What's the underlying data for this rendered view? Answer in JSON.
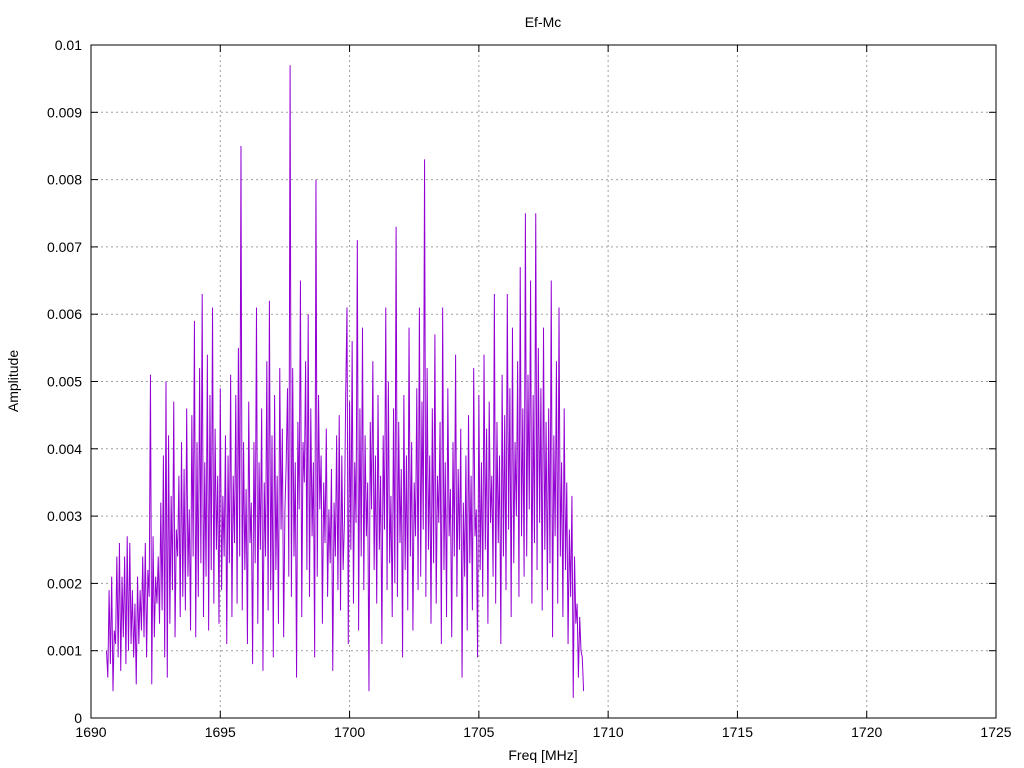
{
  "chart_data": {
    "type": "line",
    "title": "Ef-Mc",
    "xlabel": "Freq [MHz]",
    "ylabel": "Amplitude",
    "xlim": [
      1690,
      1725
    ],
    "ylim": [
      0,
      0.01
    ],
    "x_ticks": [
      "1690",
      "1695",
      "1700",
      "1705",
      "1710",
      "1715",
      "1720",
      "1725"
    ],
    "y_ticks": [
      "0",
      "0.001",
      "0.002",
      "0.003",
      "0.004",
      "0.005",
      "0.006",
      "0.007",
      "0.008",
      "0.009",
      "0.01"
    ],
    "grid": true,
    "legend": "none",
    "series": [
      {
        "color": "#9400d3",
        "x_start": 1690.6,
        "x_step": 0.05,
        "values": [
          0.001,
          0.0006,
          0.0019,
          0.0008,
          0.0021,
          0.0004,
          0.0013,
          0.0011,
          0.0024,
          0.0009,
          0.0026,
          0.0007,
          0.0021,
          0.0012,
          0.0024,
          0.0008,
          0.0027,
          0.001,
          0.0026,
          0.0011,
          0.0019,
          0.0009,
          0.0017,
          0.0005,
          0.0021,
          0.0011,
          0.0019,
          0.0013,
          0.0024,
          0.0012,
          0.0026,
          0.0009,
          0.0022,
          0.0018,
          0.0051,
          0.0005,
          0.0027,
          0.0012,
          0.0021,
          0.0017,
          0.0024,
          0.0014,
          0.0032,
          0.0016,
          0.0039,
          0.0009,
          0.005,
          0.0006,
          0.0042,
          0.0014,
          0.0033,
          0.0019,
          0.0047,
          0.0012,
          0.0028,
          0.0024,
          0.0036,
          0.0015,
          0.0041,
          0.0018,
          0.0037,
          0.0016,
          0.0046,
          0.0021,
          0.0031,
          0.0013,
          0.0045,
          0.0024,
          0.0059,
          0.0012,
          0.0041,
          0.0018,
          0.0052,
          0.0023,
          0.0063,
          0.0015,
          0.0038,
          0.0021,
          0.0054,
          0.0013,
          0.0048,
          0.0022,
          0.0061,
          0.0017,
          0.0043,
          0.0025,
          0.0036,
          0.0014,
          0.0049,
          0.0019,
          0.0033,
          0.0024,
          0.0042,
          0.0011,
          0.0039,
          0.0023,
          0.0051,
          0.0015,
          0.0036,
          0.0026,
          0.0048,
          0.0017,
          0.0055,
          0.0024,
          0.0085,
          0.0016,
          0.0041,
          0.0022,
          0.0034,
          0.0011,
          0.0047,
          0.0026,
          0.0032,
          0.0008,
          0.0041,
          0.0023,
          0.0061,
          0.0014,
          0.0038,
          0.0025,
          0.0046,
          0.0007,
          0.0035,
          0.0024,
          0.0053,
          0.0016,
          0.0062,
          0.0019,
          0.0042,
          0.0009,
          0.0048,
          0.0022,
          0.0036,
          0.0014,
          0.0052,
          0.0028,
          0.0043,
          0.0012,
          0.0031,
          0.0038,
          0.0049,
          0.0021,
          0.0097,
          0.0018,
          0.0052,
          0.0024,
          0.0038,
          0.0006,
          0.0044,
          0.0031,
          0.0065,
          0.0015,
          0.0041,
          0.0035,
          0.0053,
          0.0022,
          0.006,
          0.0018,
          0.0046,
          0.0027,
          0.0038,
          0.0009,
          0.008,
          0.0021,
          0.0048,
          0.0031,
          0.0039,
          0.0014,
          0.0035,
          0.0026,
          0.0043,
          0.0018,
          0.0031,
          0.0023,
          0.0037,
          0.0007,
          0.0032,
          0.0024,
          0.0042,
          0.0019,
          0.0045,
          0.0016,
          0.0039,
          0.0022,
          0.0029,
          0.0048,
          0.0061,
          0.0011,
          0.0047,
          0.0025,
          0.0056,
          0.0017,
          0.0038,
          0.0029,
          0.0071,
          0.0013,
          0.0046,
          0.0024,
          0.0058,
          0.0019,
          0.0042,
          0.0027,
          0.0035,
          0.0004,
          0.0044,
          0.0031,
          0.0053,
          0.0022,
          0.0039,
          0.0017,
          0.0048,
          0.0025,
          0.0036,
          0.0011,
          0.0042,
          0.0028,
          0.0061,
          0.0019,
          0.005,
          0.0023,
          0.0033,
          0.0015,
          0.0046,
          0.002,
          0.0073,
          0.0018,
          0.0044,
          0.0026,
          0.0037,
          0.0009,
          0.0048,
          0.0022,
          0.0039,
          0.0016,
          0.0058,
          0.0024,
          0.0041,
          0.0013,
          0.0035,
          0.0027,
          0.0049,
          0.0019,
          0.0061,
          0.0021,
          0.0047,
          0.0028,
          0.0083,
          0.0018,
          0.0052,
          0.0025,
          0.0039,
          0.0014,
          0.0046,
          0.0023,
          0.0057,
          0.0017,
          0.0036,
          0.0029,
          0.0044,
          0.0011,
          0.0061,
          0.0022,
          0.0038,
          0.0015,
          0.0049,
          0.0027,
          0.0034,
          0.0012,
          0.0041,
          0.0024,
          0.0054,
          0.0018,
          0.0037,
          0.0025,
          0.0043,
          0.0006,
          0.0032,
          0.0021,
          0.0039,
          0.0013,
          0.0045,
          0.0023,
          0.0036,
          0.0016,
          0.0052,
          0.0027,
          0.0031,
          0.0009,
          0.0048,
          0.0022,
          0.0038,
          0.0018,
          0.0054,
          0.0025,
          0.0043,
          0.0014,
          0.0047,
          0.0029,
          0.0036,
          0.0021,
          0.0063,
          0.0017,
          0.0044,
          0.0026,
          0.0039,
          0.0011,
          0.0051,
          0.0024,
          0.0045,
          0.0019,
          0.0063,
          0.0028,
          0.0049,
          0.0015,
          0.0058,
          0.0023,
          0.0041,
          0.003,
          0.0053,
          0.0018,
          0.0067,
          0.0027,
          0.0046,
          0.0021,
          0.0075,
          0.0024,
          0.0051,
          0.0031,
          0.0065,
          0.0017,
          0.0048,
          0.0026,
          0.0075,
          0.0022,
          0.0055,
          0.0029,
          0.0049,
          0.0016,
          0.0058,
          0.0025,
          0.0044,
          0.0019,
          0.0046,
          0.0023,
          0.0065,
          0.0012,
          0.0042,
          0.0027,
          0.0053,
          0.0017,
          0.0061,
          0.0024,
          0.0038,
          0.0015,
          0.0046,
          0.0022,
          0.0035,
          0.0011,
          0.0028,
          0.0018,
          0.0033,
          0.0003,
          0.0024,
          0.0014,
          0.0017,
          0.0006,
          0.0015,
          0.001,
          0.0009,
          0.0004
        ]
      }
    ]
  }
}
